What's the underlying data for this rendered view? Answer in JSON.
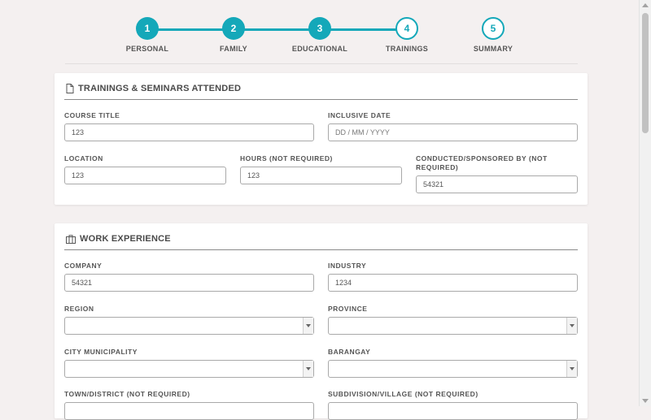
{
  "stepper": {
    "steps": [
      {
        "number": "1",
        "label": "PERSONAL",
        "state": "done"
      },
      {
        "number": "2",
        "label": "FAMILY",
        "state": "done"
      },
      {
        "number": "3",
        "label": "EDUCATIONAL",
        "state": "done"
      },
      {
        "number": "4",
        "label": "TRAININGS",
        "state": "current"
      },
      {
        "number": "5",
        "label": "SUMMARY",
        "state": "todo"
      }
    ],
    "accent_color": "#14a8b9"
  },
  "trainings": {
    "title": "TRAININGS & SEMINARS ATTENDED",
    "icon": "document-icon",
    "course_title": {
      "label": "COURSE TITLE",
      "value": "123"
    },
    "inclusive_date": {
      "label": "INCLUSIVE DATE",
      "placeholder": "DD / MM / YYYY"
    },
    "location": {
      "label": "LOCATION",
      "value": "123"
    },
    "hours": {
      "label": "HOURS (NOT REQUIRED)",
      "value": "123"
    },
    "conducted_by": {
      "label": "CONDUCTED/SPONSORED BY (NOT REQUIRED)",
      "value": "54321"
    }
  },
  "work": {
    "title": "WORK EXPERIENCE",
    "icon": "briefcase-icon",
    "company": {
      "label": "COMPANY",
      "value": "54321"
    },
    "industry": {
      "label": "INDUSTRY",
      "value": "1234"
    },
    "region": {
      "label": "REGION",
      "value": ""
    },
    "province": {
      "label": "PROVINCE",
      "value": ""
    },
    "city": {
      "label": "CITY MUNICIPALITY",
      "value": ""
    },
    "barangay": {
      "label": "BARANGAY",
      "value": ""
    },
    "town": {
      "label": "TOWN/DISTRICT (NOT REQUIRED)"
    },
    "subdivision": {
      "label": "SUBDIVISION/VILLAGE (NOT REQUIRED)"
    }
  }
}
